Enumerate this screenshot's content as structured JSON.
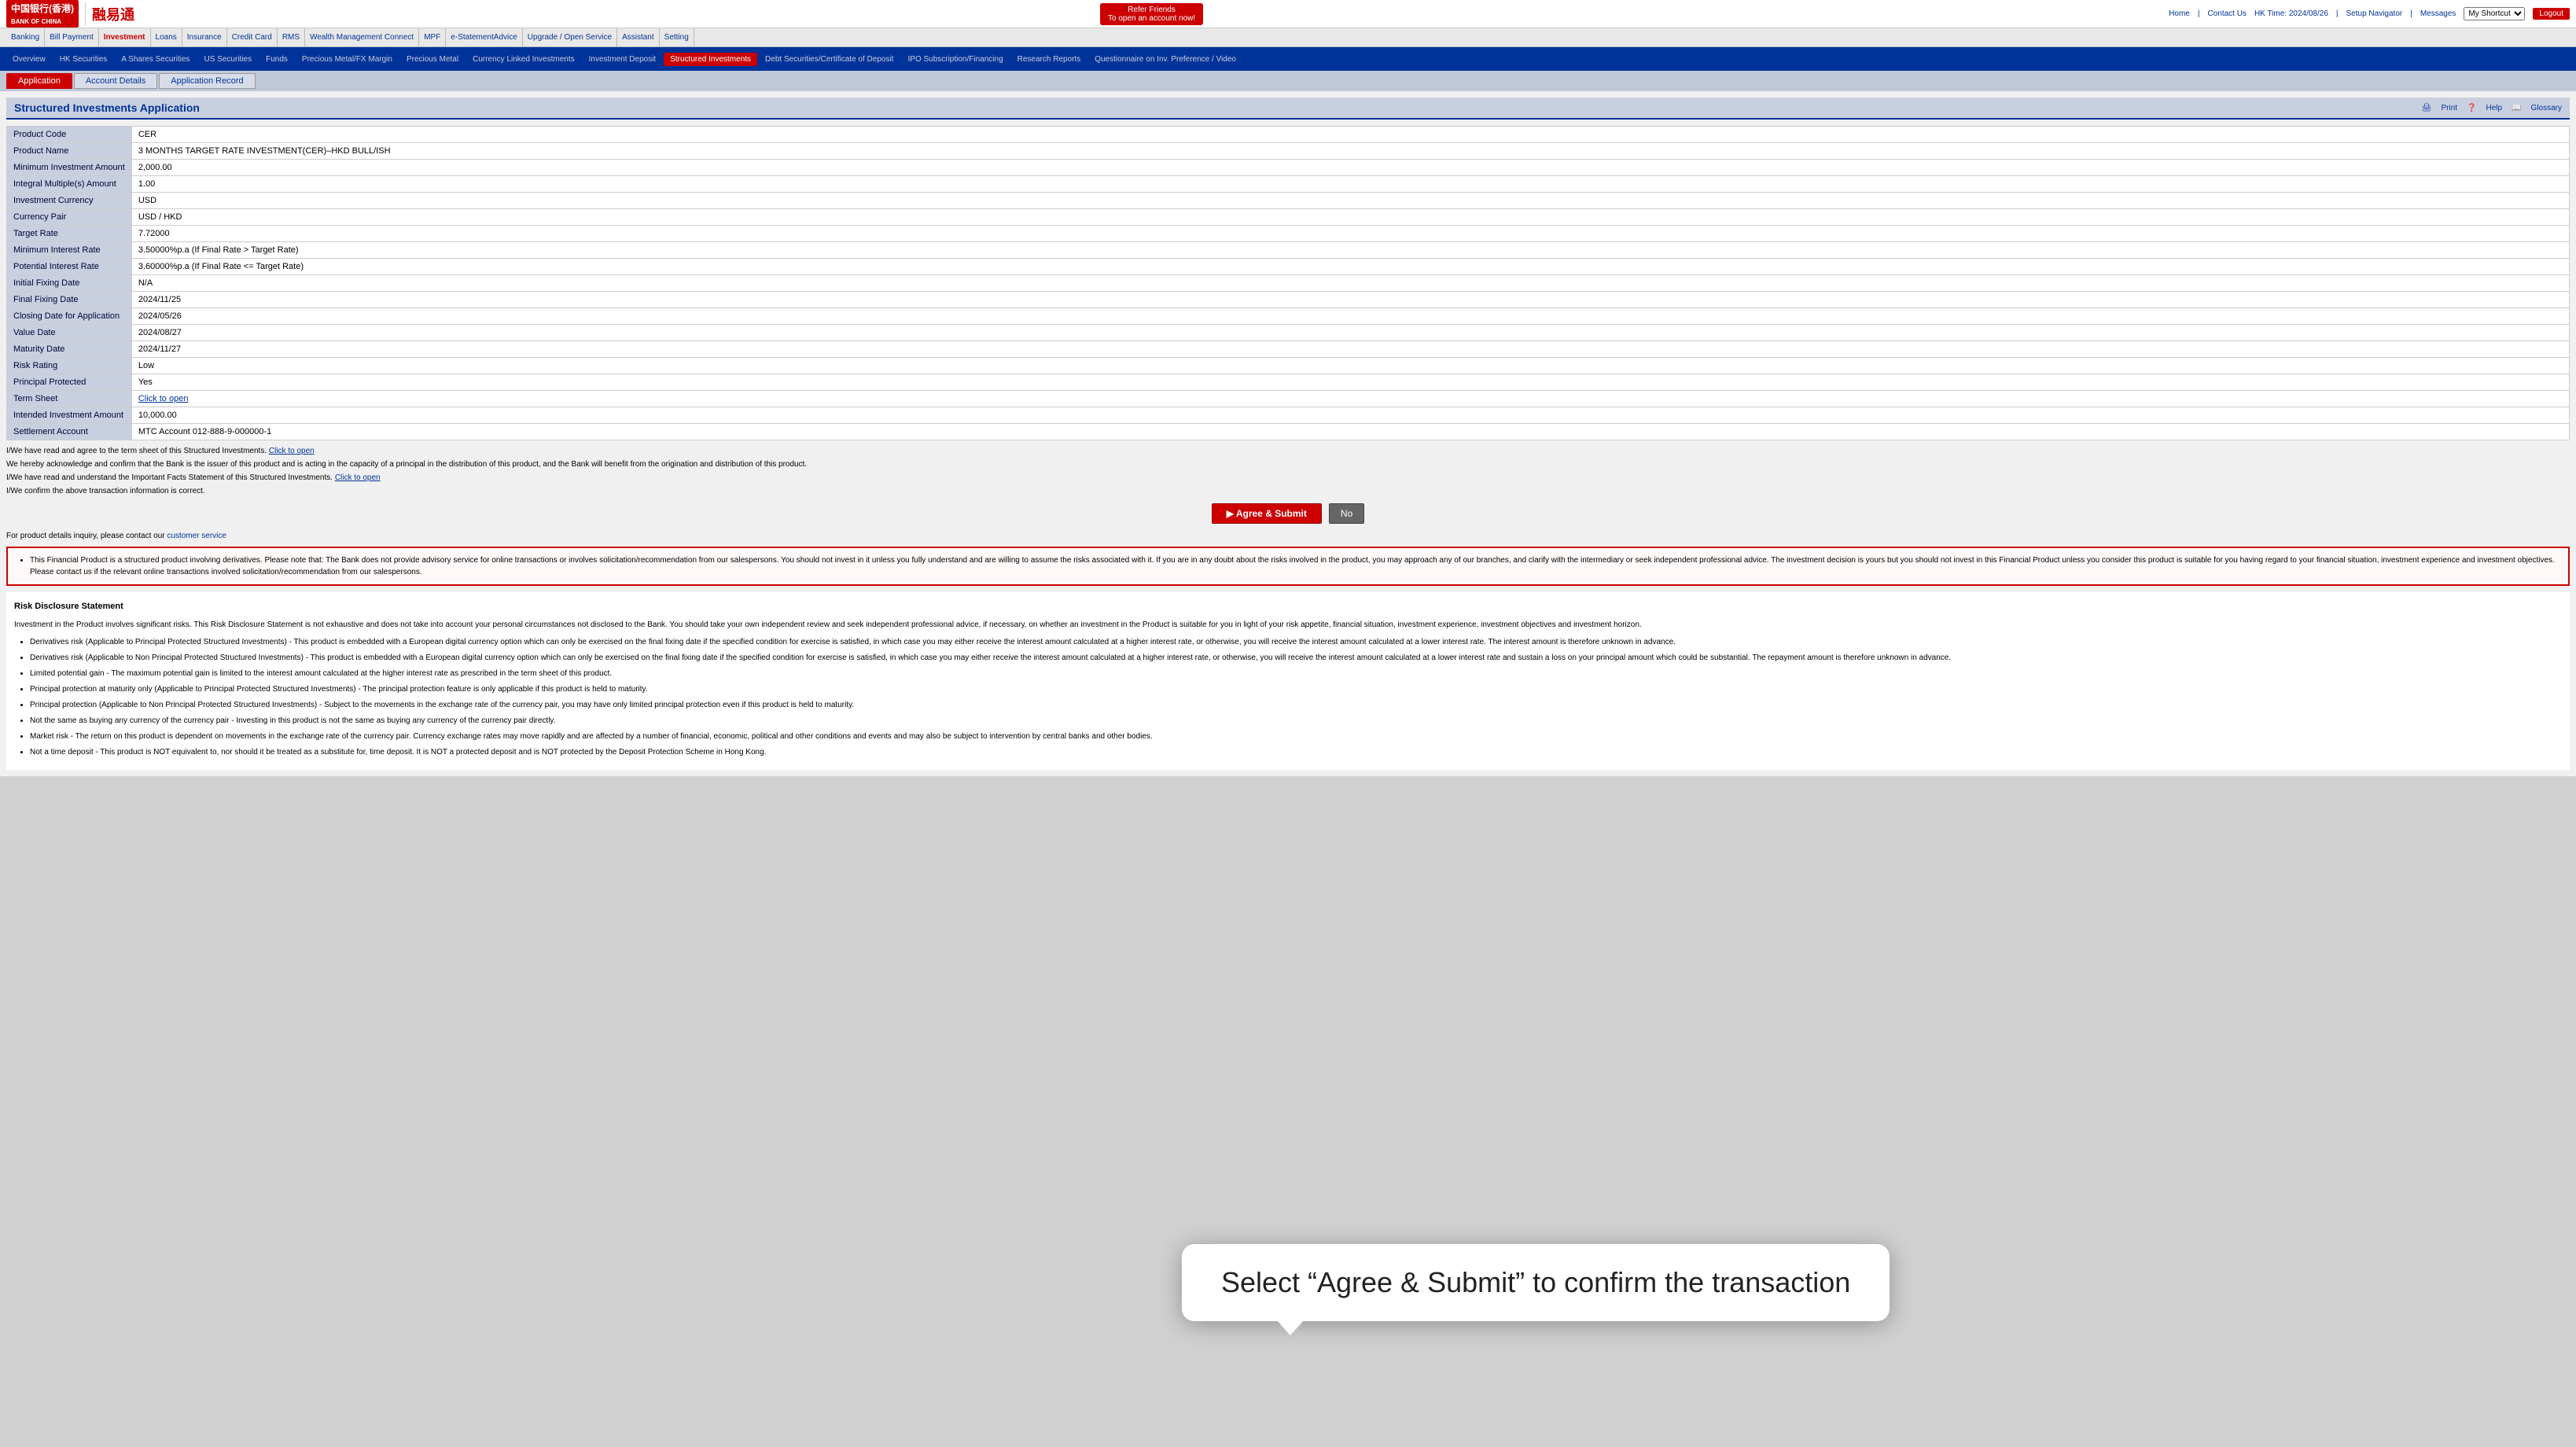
{
  "header": {
    "logo_text": "中国银行(香港)",
    "logo_sub": "BANK OF CHINA",
    "refer_line1": "Refer Friends",
    "refer_line2": "To open an account now!",
    "hk_time_label": "HK Time: 2024/08/26",
    "home_link": "Home",
    "contact_link": "Contact Us",
    "setup_nav": "Setup Navigator",
    "messages": "Messages",
    "my_shortcut_placeholder": "My Shortcut",
    "logout_label": "Logout"
  },
  "main_nav": {
    "items": [
      {
        "label": "Banking",
        "active": false
      },
      {
        "label": "Bill Payment",
        "active": false
      },
      {
        "label": "Investment",
        "active": true
      },
      {
        "label": "Loans",
        "active": false
      },
      {
        "label": "Insurance",
        "active": false
      },
      {
        "label": "Credit Card",
        "active": false
      },
      {
        "label": "RMS",
        "active": false
      },
      {
        "label": "Wealth Management Connect",
        "active": false
      },
      {
        "label": "MPF",
        "active": false
      },
      {
        "label": "e-StatementAdvice",
        "active": false
      },
      {
        "label": "Upgrade / Open Service",
        "active": false
      },
      {
        "label": "Assistant",
        "active": false
      },
      {
        "label": "Setting",
        "active": false
      }
    ]
  },
  "sub_nav": {
    "items": [
      {
        "label": "Overview",
        "active": false
      },
      {
        "label": "HK Securities",
        "active": false
      },
      {
        "label": "A Shares Securities",
        "active": false
      },
      {
        "label": "US Securities",
        "active": false
      },
      {
        "label": "Funds",
        "active": false
      },
      {
        "label": "Precious Metal/FX Margin",
        "active": false
      },
      {
        "label": "Precious Metal",
        "active": false
      },
      {
        "label": "Currency Linked Investments",
        "active": false
      },
      {
        "label": "Investment Deposit",
        "active": false
      },
      {
        "label": "Structured Investments",
        "active": true
      },
      {
        "label": "Debt Securities/Certificate of Deposit",
        "active": false
      },
      {
        "label": "IPO Subscription/Financing",
        "active": false
      },
      {
        "label": "Research Reports",
        "active": false
      },
      {
        "label": "Questionnaire on Inv. Preference / Video",
        "active": false
      }
    ]
  },
  "tabs": [
    {
      "label": "Application",
      "active": true
    },
    {
      "label": "Account Details",
      "active": false
    },
    {
      "label": "Application Record",
      "active": false
    }
  ],
  "page_title": "Structured Investments Application",
  "title_actions": {
    "print": "Print",
    "help": "Help",
    "glossary": "Glossary"
  },
  "form_rows": [
    {
      "label": "Product Code",
      "value": "CER"
    },
    {
      "label": "Product Name",
      "value": "3 MONTHS TARGET RATE INVESTMENT(CER)–HKD BULL/ISH"
    },
    {
      "label": "Minimum Investment Amount",
      "value": "2,000.00"
    },
    {
      "label": "Integral Multiple(s) Amount",
      "value": "1.00"
    },
    {
      "label": "Investment Currency",
      "value": "USD"
    },
    {
      "label": "Currency Pair",
      "value": "USD / HKD"
    },
    {
      "label": "Target Rate",
      "value": "7.72000"
    },
    {
      "label": "Minimum Interest Rate",
      "value": "3.50000%p.a (If Final Rate > Target Rate)"
    },
    {
      "label": "Potential Interest Rate",
      "value": "3.60000%p.a (If Final Rate <= Target Rate)"
    },
    {
      "label": "Initial Fixing Date",
      "value": "N/A"
    },
    {
      "label": "Final Fixing Date",
      "value": "2024/11/25"
    },
    {
      "label": "Closing Date for Application",
      "value": "2024/05/26"
    },
    {
      "label": "Value Date",
      "value": "2024/08/27"
    },
    {
      "label": "Maturity Date",
      "value": "2024/11/27"
    },
    {
      "label": "Risk Rating",
      "value": "Low"
    },
    {
      "label": "Principal Protected",
      "value": "Yes"
    },
    {
      "label": "Term Sheet",
      "value": "Click to open"
    },
    {
      "label": "Intended Investment Amount",
      "value": "10,000.00"
    },
    {
      "label": "Settlement Account",
      "value": "MTC Account 012-888-9-000000-1"
    }
  ],
  "notices": [
    {
      "text": "I/We have read and agree to the term sheet of this Structured Investments.",
      "link_text": "Click to open",
      "link_href": "#"
    },
    {
      "text": "We hereby acknowledge and confirm that the Bank is the issuer of this product and is acting in the capacity of a principal in the distribution of this product, and the Bank will benefit from the origination and distribution of this product.",
      "link_text": "",
      "link_href": ""
    },
    {
      "text": "I/We have read and understand the Important Facts Statement of this Structured Investments.",
      "link_text": "Click to open",
      "link_href": "#"
    },
    {
      "text": "I/We confirm the above transaction information is correct.",
      "link_text": "",
      "link_href": ""
    }
  ],
  "buttons": {
    "agree_submit": "Agree & Submit",
    "no": "No"
  },
  "contact_text": "For product details inquiry, please contact our",
  "contact_link_text": "customer service",
  "warning_text": "This Financial Product is a structured product involving derivatives. Please note that: The Bank does not provide advisory service for online transactions or involves solicitation/recommendation from our salespersons. You should not invest in it unless you fully understand and are willing to assume the risks associated with it. If you are in any doubt about the risks involved in the product, you may approach any of our branches, and clarify with the intermediary or seek independent professional advice. The investment decision is yours but you should not invest in this Financial Product unless you consider this product is suitable for you having regard to your financial situation, investment experience and investment objectives. Please contact us if the relevant online transactions involved solicitation/recommendation from our salespersons.",
  "risk_section": {
    "title": "Risk Disclosure Statement",
    "intro": "Investment in the Product involves significant risks. This Risk Disclosure Statement is not exhaustive and does not take into account your personal circumstances not disclosed to the Bank. You should take your own independent review and seek independent professional advice, if necessary, on whether an investment in the Product is suitable for you in light of your risk appetite, financial situation, investment experience, investment objectives and investment horizon.",
    "items": [
      "Derivatives risk (Applicable to Principal Protected Structured Investments) - This product is embedded with a European digital currency option which can only be exercised on the final fixing date if the specified condition for exercise is satisfied, in which case you may either receive the interest amount calculated at a higher interest rate, or otherwise, you will receive the interest amount calculated at a lower interest rate. The interest amount is therefore unknown in advance.",
      "Derivatives risk (Applicable to Non Principal Protected Structured Investments) - This product is embedded with a European digital currency option which can only be exercised on the final fixing date if the specified condition for exercise is satisfied, in which case you may either receive the interest amount calculated at a higher interest rate, or otherwise, you will receive the interest amount calculated at a lower interest rate and sustain a loss on your principal amount which could be substantial. The repayment amount is therefore unknown in advance.",
      "Limited potential gain - The maximum potential gain is limited to the interest amount calculated at the higher interest rate as prescribed in the term sheet of this product.",
      "Principal protection at maturity only (Applicable to Principal Protected Structured Investments) - The principal protection feature is only applicable if this product is held to maturity.",
      "Principal protection (Applicable to Non Principal Protected Structured Investments) - Subject to the movements in the exchange rate of the currency pair, you may have only limited principal protection even if this product is held to maturity.",
      "Not the same as buying any currency of the currency pair - Investing in this product is not the same as buying any currency of the currency pair directly.",
      "Market risk - The return on this product is dependent on movements in the exchange rate of the currency pair. Currency exchange rates may move rapidly and are affected by a number of financial, economic, political and other conditions and events and may also be subject to intervention by central banks and other bodies.",
      "Not a time deposit - This product is NOT equivalent to, nor should it be treated as a substitute for, time deposit. It is NOT a protected deposit and is NOT protected by the Deposit Protection Scheme in Hong Kong."
    ]
  },
  "tooltip": {
    "text": "Select “Agree & Submit” to confirm the transaction"
  },
  "colors": {
    "primary_blue": "#003399",
    "accent_red": "#cc0000",
    "label_bg": "#c8d0e0",
    "nav_bg": "#003399"
  }
}
